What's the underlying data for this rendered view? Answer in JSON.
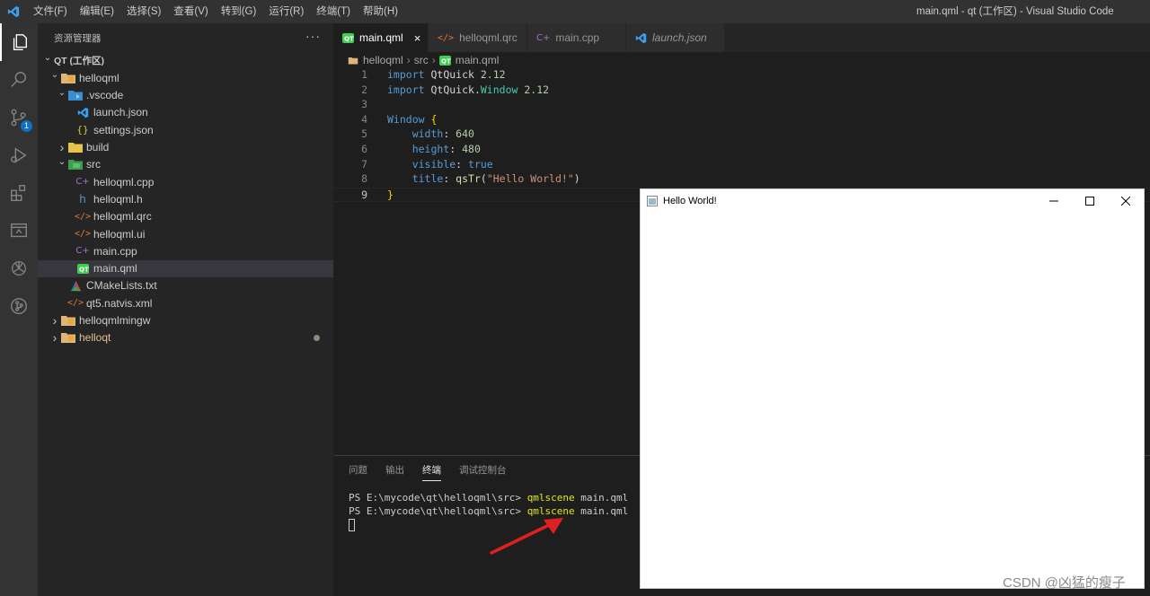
{
  "titlebar": {
    "menu": [
      "文件(F)",
      "编辑(E)",
      "选择(S)",
      "查看(V)",
      "转到(G)",
      "运行(R)",
      "终端(T)",
      "帮助(H)"
    ],
    "window_title": "main.qml - qt (工作区) - Visual Studio Code"
  },
  "activity_bar": {
    "icons": [
      "explorer-icon",
      "search-icon",
      "source-control-icon",
      "run-debug-icon",
      "extensions-icon",
      "remote-explorer-icon",
      "openai-icon",
      "git-graph-icon"
    ],
    "scm_badge": "1"
  },
  "sidebar": {
    "header": "资源管理器",
    "more": "···",
    "tree": [
      {
        "label": "QT (工作区)",
        "depth": 0,
        "chev": "down",
        "icon": "none"
      },
      {
        "label": "helloqml",
        "depth": 1,
        "chev": "down",
        "icon": "folder-qt"
      },
      {
        "label": ".vscode",
        "depth": 2,
        "chev": "down",
        "icon": "folder-vscode"
      },
      {
        "label": "launch.json",
        "depth": 3,
        "chev": "",
        "icon": "vscode"
      },
      {
        "label": "settings.json",
        "depth": 3,
        "chev": "",
        "icon": "json"
      },
      {
        "label": "build",
        "depth": 2,
        "chev": "right",
        "icon": "folder-build"
      },
      {
        "label": "src",
        "depth": 2,
        "chev": "down",
        "icon": "folder-src"
      },
      {
        "label": "helloqml.cpp",
        "depth": 3,
        "chev": "",
        "icon": "cpp"
      },
      {
        "label": "helloqml.h",
        "depth": 3,
        "chev": "",
        "icon": "h"
      },
      {
        "label": "helloqml.qrc",
        "depth": 3,
        "chev": "",
        "icon": "xml"
      },
      {
        "label": "helloqml.ui",
        "depth": 3,
        "chev": "",
        "icon": "xml"
      },
      {
        "label": "main.cpp",
        "depth": 3,
        "chev": "",
        "icon": "cpp"
      },
      {
        "label": "main.qml",
        "depth": 3,
        "chev": "",
        "icon": "qml",
        "selected": true
      },
      {
        "label": "CMakeLists.txt",
        "depth": 2,
        "chev": "",
        "icon": "cmake"
      },
      {
        "label": "qt5.natvis.xml",
        "depth": 2,
        "chev": "",
        "icon": "xml"
      },
      {
        "label": "helloqmlmingw",
        "depth": 1,
        "chev": "right",
        "icon": "folder-qt"
      },
      {
        "label": "helloqt",
        "depth": 1,
        "chev": "right",
        "icon": "folder-qt",
        "modified": true
      }
    ]
  },
  "tabs": [
    {
      "label": "main.qml",
      "icon": "qml",
      "active": true,
      "close": "×"
    },
    {
      "label": "helloqml.qrc",
      "icon": "xml"
    },
    {
      "label": "main.cpp",
      "icon": "cpp"
    },
    {
      "label": "launch.json",
      "icon": "vscode",
      "italic": true
    }
  ],
  "breadcrumb": [
    "helloqml",
    "src",
    "main.qml"
  ],
  "code": [
    [
      {
        "t": "import ",
        "c": "kw"
      },
      {
        "t": "QtQuick",
        "c": "pl"
      },
      {
        "t": " 2.12",
        "c": "num"
      }
    ],
    [
      {
        "t": "import ",
        "c": "kw"
      },
      {
        "t": "QtQuick",
        "c": "pl"
      },
      {
        "t": ".",
        "c": "pl"
      },
      {
        "t": "Window",
        "c": "ty"
      },
      {
        "t": " 2.12",
        "c": "num"
      }
    ],
    [],
    [
      {
        "t": "Window",
        "c": "kw"
      },
      {
        "t": " {",
        "c": "br"
      }
    ],
    [
      {
        "t": "    width",
        "c": "kw"
      },
      {
        "t": ": ",
        "c": "pl"
      },
      {
        "t": "640",
        "c": "num"
      }
    ],
    [
      {
        "t": "    height",
        "c": "kw"
      },
      {
        "t": ": ",
        "c": "pl"
      },
      {
        "t": "480",
        "c": "num"
      }
    ],
    [
      {
        "t": "    visible",
        "c": "kw"
      },
      {
        "t": ": ",
        "c": "pl"
      },
      {
        "t": "true",
        "c": "kw"
      }
    ],
    [
      {
        "t": "    title",
        "c": "kw"
      },
      {
        "t": ": ",
        "c": "pl"
      },
      {
        "t": "qsTr",
        "c": "fn"
      },
      {
        "t": "(",
        "c": "pl"
      },
      {
        "t": "\"Hello World!\"",
        "c": "str"
      },
      {
        "t": ")",
        "c": "pl"
      }
    ],
    [
      {
        "t": "}",
        "c": "br"
      }
    ]
  ],
  "current_line": 9,
  "panel": {
    "tabs": [
      "问题",
      "输出",
      "终端",
      "调试控制台"
    ],
    "active_tab": "终端",
    "terminal": [
      {
        "prompt": "PS E:\\mycode\\qt\\helloqml\\src> ",
        "cmd": "qmlscene",
        "args": " main.qml"
      },
      {
        "prompt": "PS E:\\mycode\\qt\\helloqml\\src> ",
        "cmd": "qmlscene",
        "args": " main.qml"
      }
    ]
  },
  "hello_window": {
    "title": "Hello World!",
    "minimize": "—",
    "maximize": "☐",
    "close": "✕"
  },
  "watermark": "CSDN @凶猛的瘦子",
  "colors": {
    "accent": "#0e70c0",
    "arrow": "#e02020"
  }
}
